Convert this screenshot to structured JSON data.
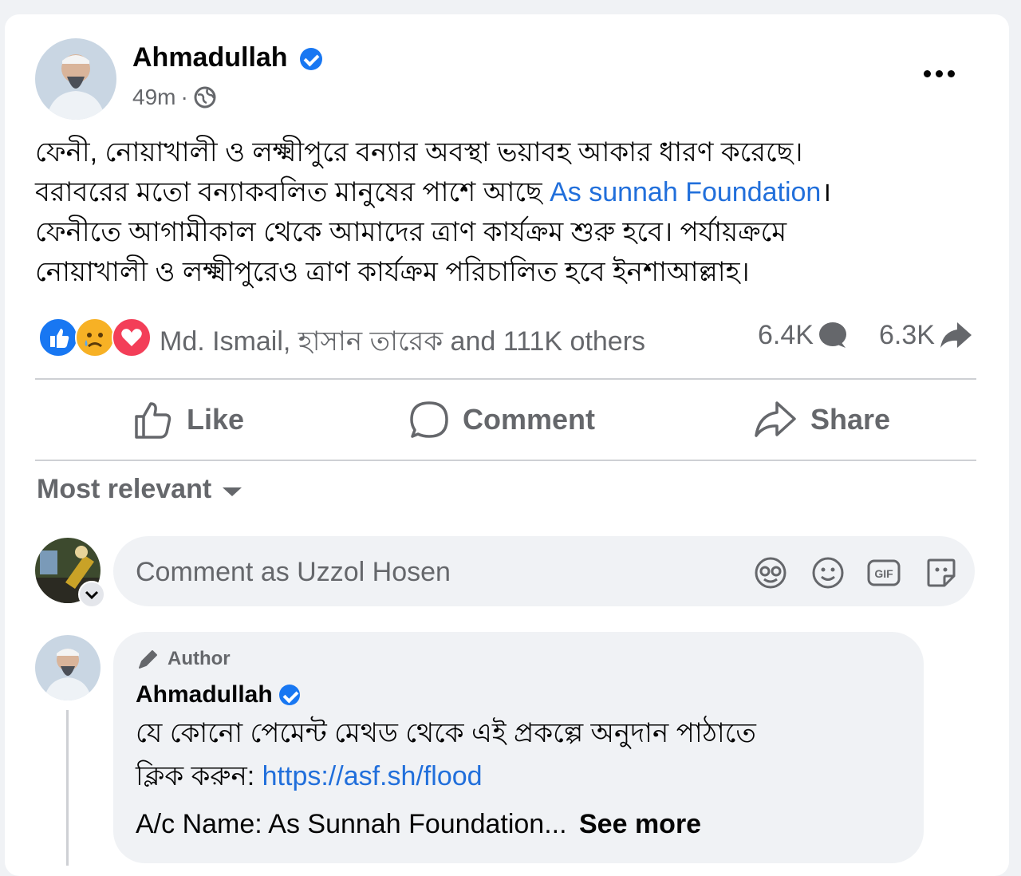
{
  "post": {
    "author": "Ahmadullah",
    "time": "49m",
    "time_sep": "·",
    "lines": [
      "ফেনী, নোয়াখালী ও লক্ষ্মীপুরে বন্যার অবস্থা ভয়াবহ আকার ধারণ করেছে।",
      "বরাবরের মতো বন্যাকবলিত মানুষের পাশে আছে ",
      "ফেনীতে আগামীকাল থেকে আমাদের ত্রাণ কার্যক্রম শুরু হবে। পর্যায়ক্রমে",
      "নোয়াখালী ও লক্ষ্মীপুরেও ত্রাণ কার্যক্রম পরিচালিত হবে ইনশাআল্লাহ।"
    ],
    "mention": "As sunnah Foundation",
    "line2_end": "।"
  },
  "reactions": {
    "summary": "Md. Ismail, হাসান তারেক and 111K others",
    "comments_count": "6.4K",
    "shares_count": "6.3K",
    "colors": {
      "like": "#1877f2",
      "love": "#f33e58",
      "sad": "#f7b125"
    }
  },
  "actions": {
    "like": "Like",
    "comment": "Comment",
    "share": "Share"
  },
  "sort": {
    "label": "Most relevant"
  },
  "composer": {
    "placeholder": "Comment as Uzzol Hosen",
    "icons": [
      "avatar-sticker-icon",
      "emoji-icon",
      "gif-icon",
      "sticker-icon"
    ],
    "gif_label": "GIF"
  },
  "reply": {
    "badge": "Author",
    "author": "Ahmadullah",
    "line1": "যে কোনো পেমেন্ট মেথড থেকে এই প্রকল্পে অনুদান পাঠাতে",
    "line2": "ক্লিক করুন: ",
    "link": "https://asf.sh/flood",
    "line3": "A/c Name: As Sunnah Foundation...",
    "see_more": "See more"
  }
}
